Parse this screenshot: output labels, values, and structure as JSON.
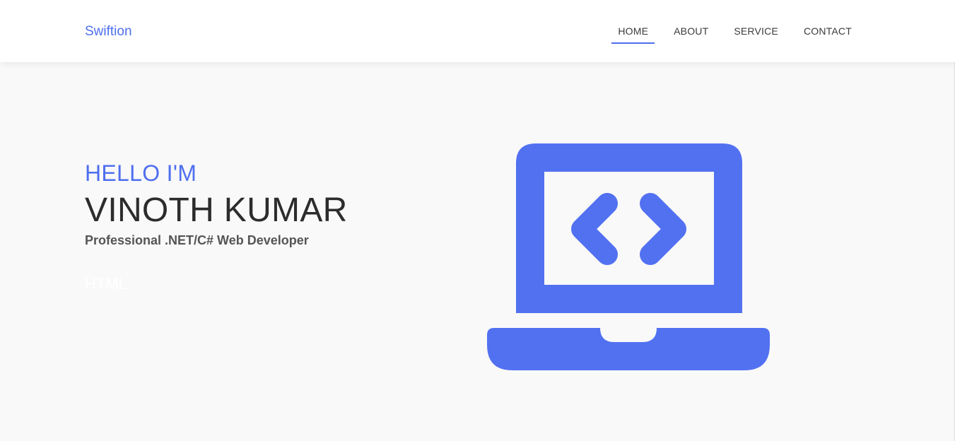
{
  "navbar": {
    "brand": "Swiftion",
    "items": [
      {
        "label": "HOME",
        "active": true
      },
      {
        "label": "ABOUT",
        "active": false
      },
      {
        "label": "SERVICE",
        "active": false
      },
      {
        "label": "CONTACT",
        "active": false
      }
    ]
  },
  "hero": {
    "greeting": "HELLO I'M",
    "name": "VINOTH KUMAR",
    "tagline": "Professional .NET/C# Web Developer",
    "typed_text": "HTML"
  },
  "illustration": {
    "icon": "laptop-code-icon",
    "color": "#5271f1"
  },
  "colors": {
    "accent": "#4f6fef",
    "background": "#f9f9f9",
    "navbar_bg": "#ffffff"
  }
}
